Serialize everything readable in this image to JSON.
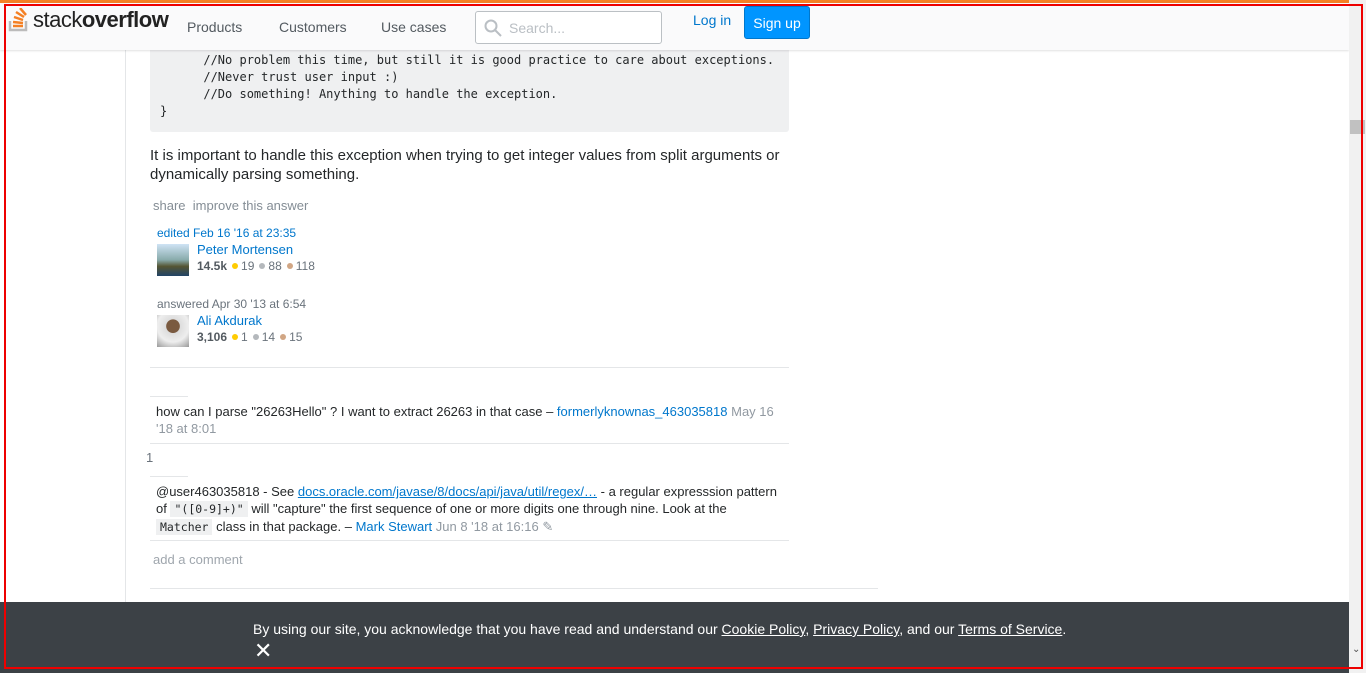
{
  "header": {
    "logo": "stackoverflow",
    "logo_light": "stack",
    "logo_bold": "overflow",
    "nav": [
      "Products",
      "Customers",
      "Use cases"
    ],
    "search_placeholder": "Search...",
    "login": "Log in",
    "signup": "Sign up"
  },
  "code_lines": [
    "      //No problem this time, but still it is good practice to care about exceptions.",
    "      //Never trust user input :)",
    "      //Do something! Anything to handle the exception.",
    "}"
  ],
  "answer_text": "It is important to handle this exception when trying to get integer values from split arguments or dynamically parsing something.",
  "post_menu": {
    "share": "share",
    "improve": "improve this answer"
  },
  "editor": {
    "action": "edited Feb 16 '16 at 23:35",
    "name": "Peter Mortensen",
    "rep": "14.5k",
    "gold": "19",
    "silver": "88",
    "bronze": "118"
  },
  "author": {
    "action": "answered Apr 30 '13 at 6:54",
    "name": "Ali Akdurak",
    "rep": "3,106",
    "gold": "1",
    "silver": "14",
    "bronze": "15"
  },
  "comments": [
    {
      "text": "how can I parse \"26263Hello\" ? I want to extract 26263 in that case – ",
      "user": "formerlyknownas_463035818",
      "date": "May 16 '18 at 8:01"
    },
    {
      "score": "1",
      "text1": "@user463035818 - See ",
      "link": "docs.oracle.com/javase/8/docs/api/java/util/regex/…",
      "text2": " - a regular expresssion pattern of ",
      "code1": "\"([0-9]+)\"",
      "text3": " will \"capture\" the first sequence of one or more digits one through nine. Look at the ",
      "code2": "Matcher",
      "text4": " class in that package. – ",
      "user": "Mark Stewart",
      "date": "Jun 8 '18 at 16:16"
    }
  ],
  "add_comment": "add a comment",
  "cookie": {
    "text1": "By using our site, you acknowledge that you have read and understand our ",
    "cookie_policy": "Cookie Policy",
    "sep1": ", ",
    "privacy_policy": "Privacy Policy",
    "text2": ", and our ",
    "terms": "Terms of Service",
    "end": ".",
    "close": "✕"
  },
  "colors": {
    "brand": "#f48024",
    "link": "#0077cc",
    "gold": "#ffcc01",
    "silver": "#b4b8bc",
    "bronze": "#d1a684"
  }
}
